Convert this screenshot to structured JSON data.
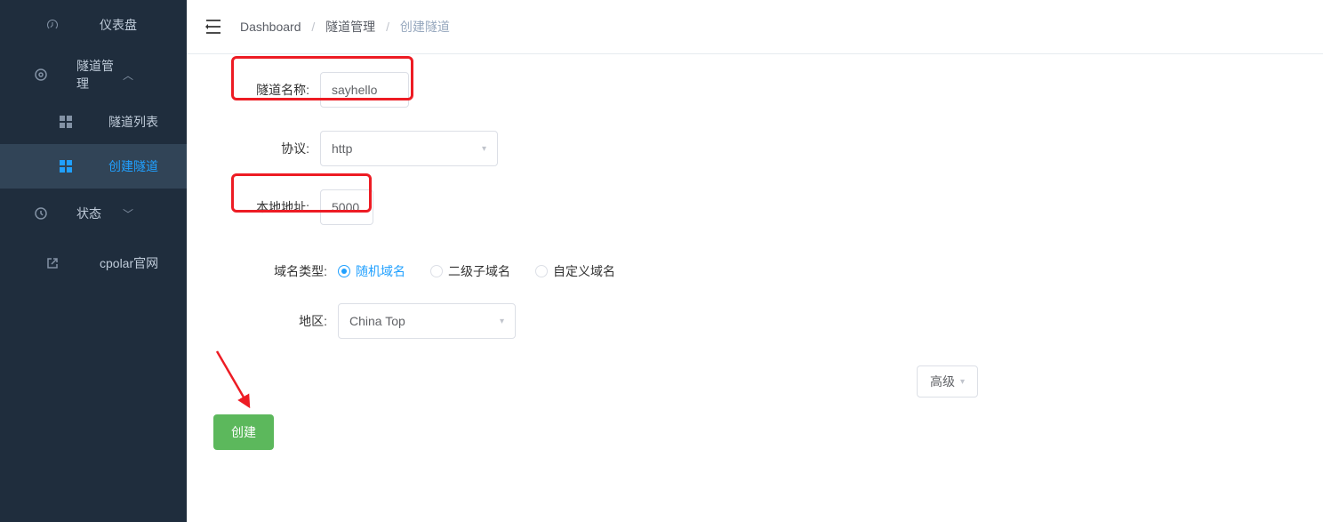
{
  "sidebar": {
    "dashboard": "仪表盘",
    "tunnel_mgmt": "隧道管理",
    "tunnel_list": "隧道列表",
    "tunnel_create": "创建隧道",
    "state": "状态",
    "cpolar_site": "cpolar官网"
  },
  "breadcrumb": {
    "b0": "Dashboard",
    "b1": "隧道管理",
    "b2": "创建隧道"
  },
  "form": {
    "tunnel_name_label": "隧道名称:",
    "tunnel_name_value": "sayhello",
    "protocol_label": "协议:",
    "protocol_value": "http",
    "local_addr_label": "本地地址:",
    "local_addr_value": "5000",
    "domain_type_label": "域名类型:",
    "domain_type_options": {
      "random": "随机域名",
      "sub": "二级子域名",
      "custom": "自定义域名"
    },
    "region_label": "地区:",
    "region_value": "China Top",
    "advanced_label": "高级",
    "create_label": "创建"
  },
  "colors": {
    "sidebar_bg": "#1f2d3d",
    "accent_blue": "#20a0ff",
    "highlight_red": "#ed1c24",
    "button_green": "#5cb85c"
  }
}
